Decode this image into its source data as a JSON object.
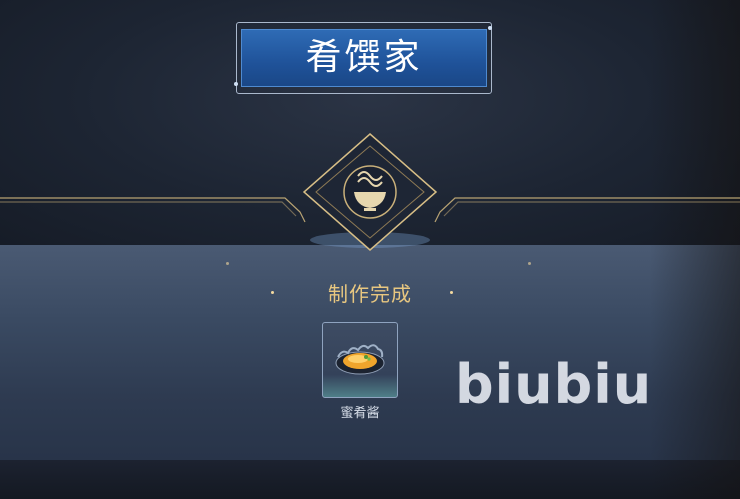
{
  "header": {
    "title": "肴馔家"
  },
  "result": {
    "status": "制作完成"
  },
  "item": {
    "name": "蜜肴酱",
    "icon": "bowl-of-sauce-icon"
  },
  "watermark": {
    "text": "biubiu"
  },
  "emblem": {
    "icon": "steaming-bowl-icon"
  },
  "colors": {
    "title_plate": "#1f5299",
    "gold_accent": "#e8c780",
    "band": "#3a4a62"
  }
}
